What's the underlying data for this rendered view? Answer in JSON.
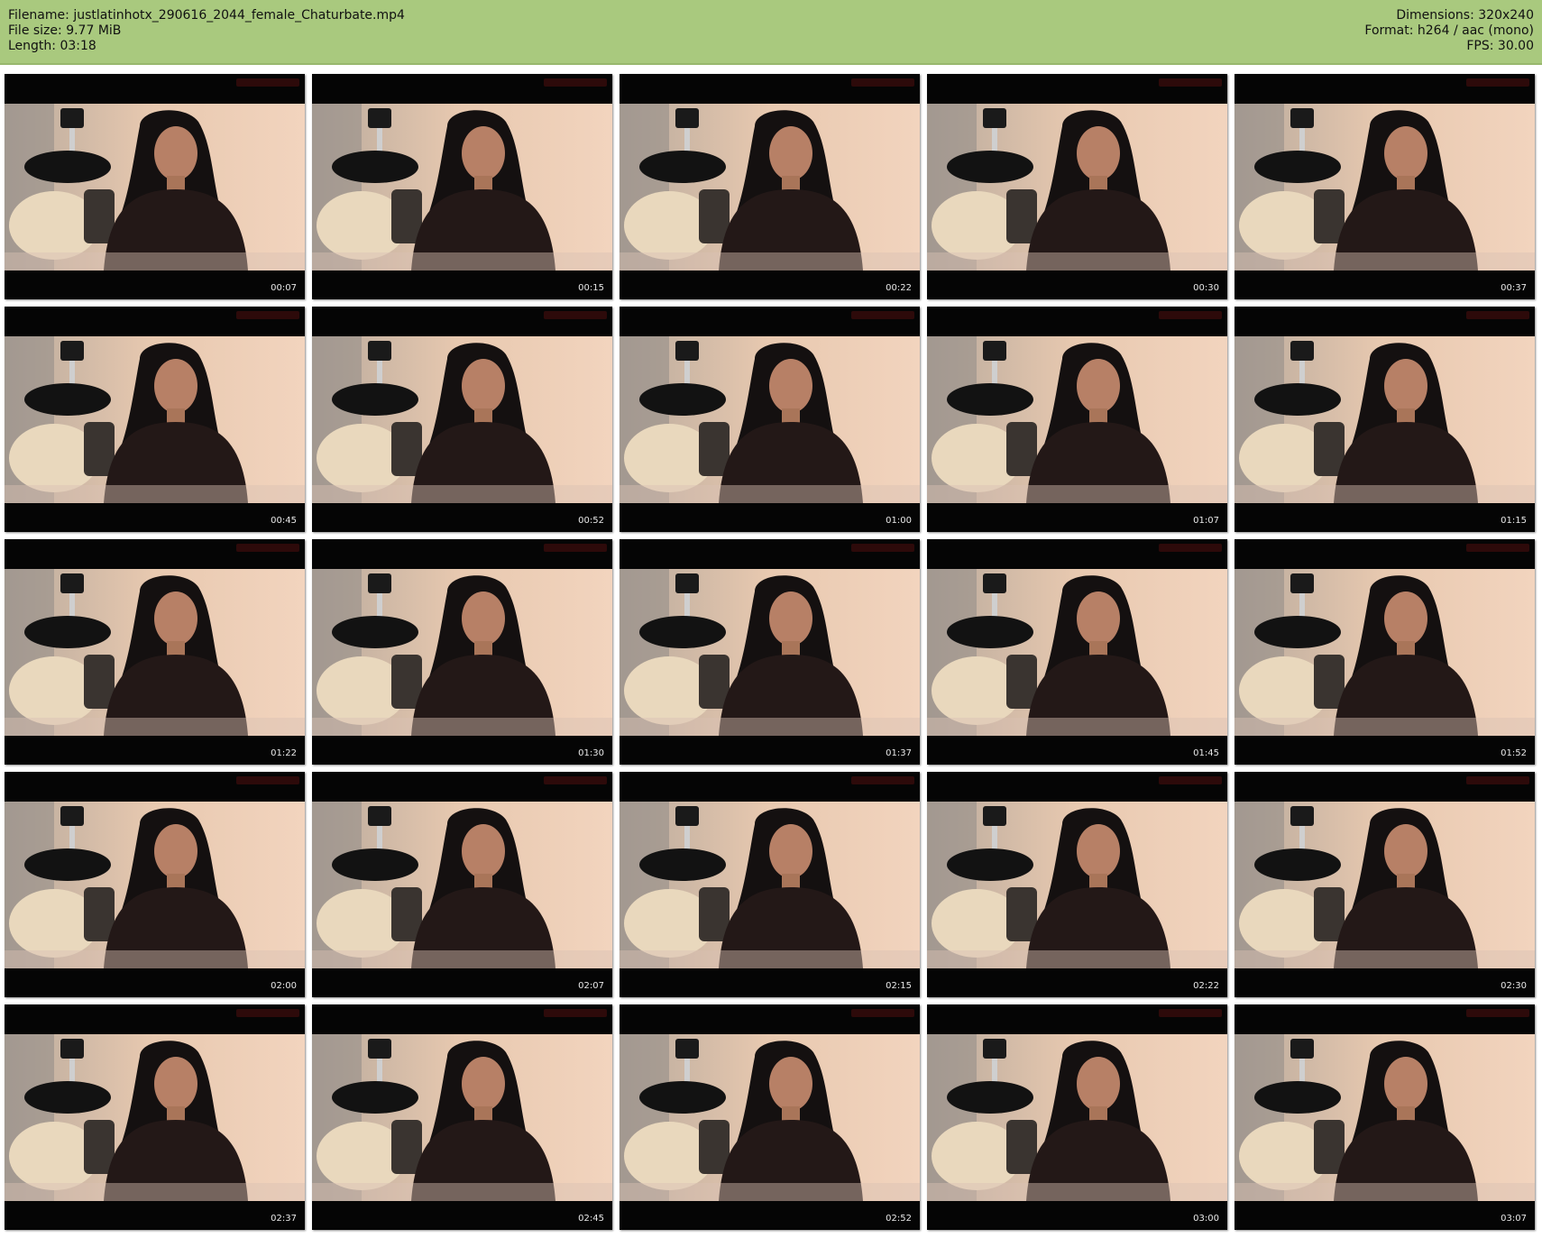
{
  "file_info": {
    "filename_label": "Filename:",
    "filename": "justlatinhotx_290616_2044_female_Chaturbate.mp4",
    "filesize_label": "File size:",
    "filesize": "9.77 MiB",
    "length_label": "Length:",
    "length": "03:18",
    "dimensions_label": "Dimensions:",
    "dimensions": "320x240",
    "format_label": "Format:",
    "format": "h264 / aac (mono)",
    "fps_label": "FPS:",
    "fps": "30.00"
  },
  "colors": {
    "header_bg": "#a9c97e",
    "page_bg": "#ffffff",
    "thumb_bg": "#050505"
  },
  "thumbnails": [
    {
      "time": "00:07"
    },
    {
      "time": "00:15"
    },
    {
      "time": "00:22"
    },
    {
      "time": "00:30"
    },
    {
      "time": "00:37"
    },
    {
      "time": "00:45"
    },
    {
      "time": "00:52"
    },
    {
      "time": "01:00"
    },
    {
      "time": "01:07"
    },
    {
      "time": "01:15"
    },
    {
      "time": "01:22"
    },
    {
      "time": "01:30"
    },
    {
      "time": "01:37"
    },
    {
      "time": "01:45"
    },
    {
      "time": "01:52"
    },
    {
      "time": "02:00"
    },
    {
      "time": "02:07"
    },
    {
      "time": "02:15"
    },
    {
      "time": "02:22"
    },
    {
      "time": "02:30"
    },
    {
      "time": "02:37"
    },
    {
      "time": "02:45"
    },
    {
      "time": "02:52"
    },
    {
      "time": "03:00"
    },
    {
      "time": "03:07"
    }
  ]
}
